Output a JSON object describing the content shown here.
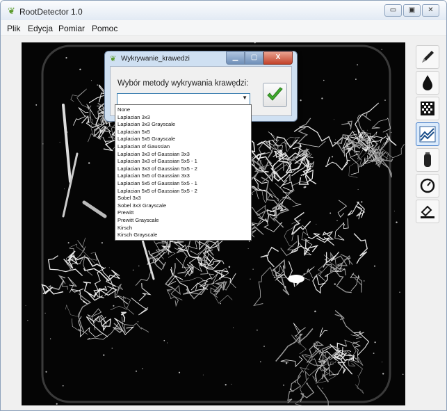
{
  "window": {
    "title": "RootDetector 1.0",
    "controls": [
      "▭",
      "▣",
      "✕"
    ]
  },
  "menu": {
    "items": [
      "Plik",
      "Edycja",
      "Pomiar",
      "Pomoc"
    ]
  },
  "toolbar": {
    "tools": [
      {
        "icon": "pencil-icon",
        "active": false
      },
      {
        "icon": "droplet-icon",
        "active": false
      },
      {
        "icon": "grid-icon",
        "active": false
      },
      {
        "icon": "edge-detection-icon",
        "active": true
      },
      {
        "icon": "capsule-icon",
        "active": false
      },
      {
        "icon": "circle-icon",
        "active": false
      },
      {
        "icon": "ruler-icon",
        "active": false
      }
    ]
  },
  "dialog": {
    "title": "Wykrywanie_krawedzi",
    "controls": [
      "▁",
      "▢",
      "X"
    ],
    "label": "Wybór metody wykrywania krawędzi:",
    "combo_value": ""
  },
  "dropdown": {
    "options": [
      "None",
      "Laplacian 3x3",
      "Laplacian 3x3 Grayscale",
      "Laplacian 5x5",
      "Laplacian 5x5 Grayscale",
      "Laplacian of Gaussian",
      "Laplacian 3x3 of Gaussian 3x3",
      "Laplacian 3x3 of Gaussian 5x5 - 1",
      "Laplacian 3x3 of Gaussian 5x5 - 2",
      "Laplacian 5x5 of Gaussian 3x3",
      "Laplacian 5x5 of Gaussian 5x5 - 1",
      "Laplacian 5x5 of Gaussian 5x5 - 2",
      "Sobel 3x3",
      "Sobel 3x3 Grayscale",
      "Prewitt",
      "Prewitt Grayscale",
      "Kirsch",
      "Kirsch Grayscale"
    ]
  },
  "colors": {
    "canvas_bg": "#050505",
    "accent": "#3c7fb1",
    "ok_check": "#3faa2c"
  }
}
